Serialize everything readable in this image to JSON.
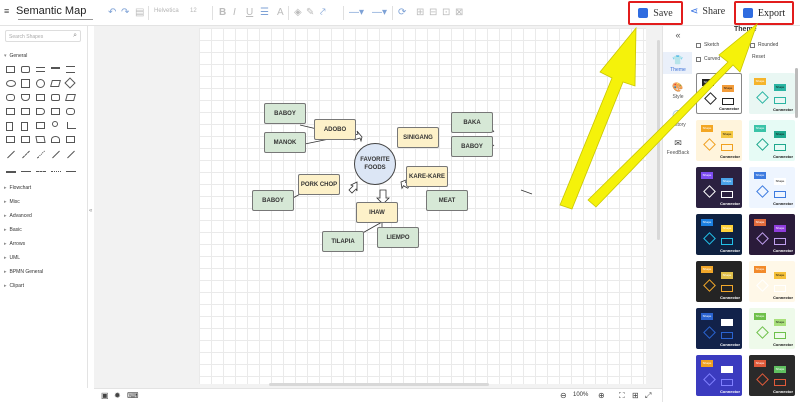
{
  "document": {
    "title": "Semantic Map"
  },
  "toolbar": {
    "font_name": "Helvetica",
    "font_size": "12",
    "save_label": "Save",
    "share_label": "Share",
    "export_label": "Export"
  },
  "left_panel": {
    "search_placeholder": "Search Shapes",
    "categories": [
      "General",
      "Flowchart",
      "Misc",
      "Advanced",
      "Basic",
      "Arrows",
      "UML",
      "BPMN General",
      "Clipart"
    ]
  },
  "diagram": {
    "center": {
      "line1": "FAVORITE",
      "line2": "FOODS"
    },
    "nodes": {
      "adobo": "ADOBO",
      "baboy_top": "BABOY",
      "manok": "MANOK",
      "sinigang": "SINIGANG",
      "baka": "BAKA",
      "baboy_right": "BABOY",
      "kare_kare": "KARE-KARE",
      "meat": "MEAT",
      "pork_chop": "PORK CHOP",
      "baboy_left": "BABOY",
      "ihaw": "IHAW",
      "tilapia": "TILAPIA",
      "liempo": "LIEMPO"
    }
  },
  "bottom_bar": {
    "zoom": "100%"
  },
  "right_tabs": [
    "Theme",
    "Style",
    "History",
    "FeedBack"
  ],
  "theme_panel": {
    "title": "Theme",
    "options": {
      "sketch": "Sketch",
      "rounded": "Rounded",
      "curved": "Curved",
      "reset": "Reset"
    },
    "thumb_shape_label": "Shape",
    "thumb_connector_label": "Connector"
  },
  "colors": {
    "accent": "#3a6fd8",
    "highlight_border": "#e21c1c",
    "annotation_arrow": "#f5f20a",
    "node_green": "#d6e8d6",
    "node_yellow": "#fdf1c9",
    "center_node": "#dce6f5"
  },
  "icons": [
    "undo-icon",
    "redo-icon",
    "bold-icon",
    "italic-icon",
    "underline-icon",
    "save-icon",
    "share-icon",
    "export-icon",
    "search-icon",
    "theme-icon",
    "style-icon",
    "history-icon",
    "feedback-icon",
    "zoom-in-icon",
    "zoom-out-icon",
    "fit-icon",
    "fullscreen-icon"
  ]
}
